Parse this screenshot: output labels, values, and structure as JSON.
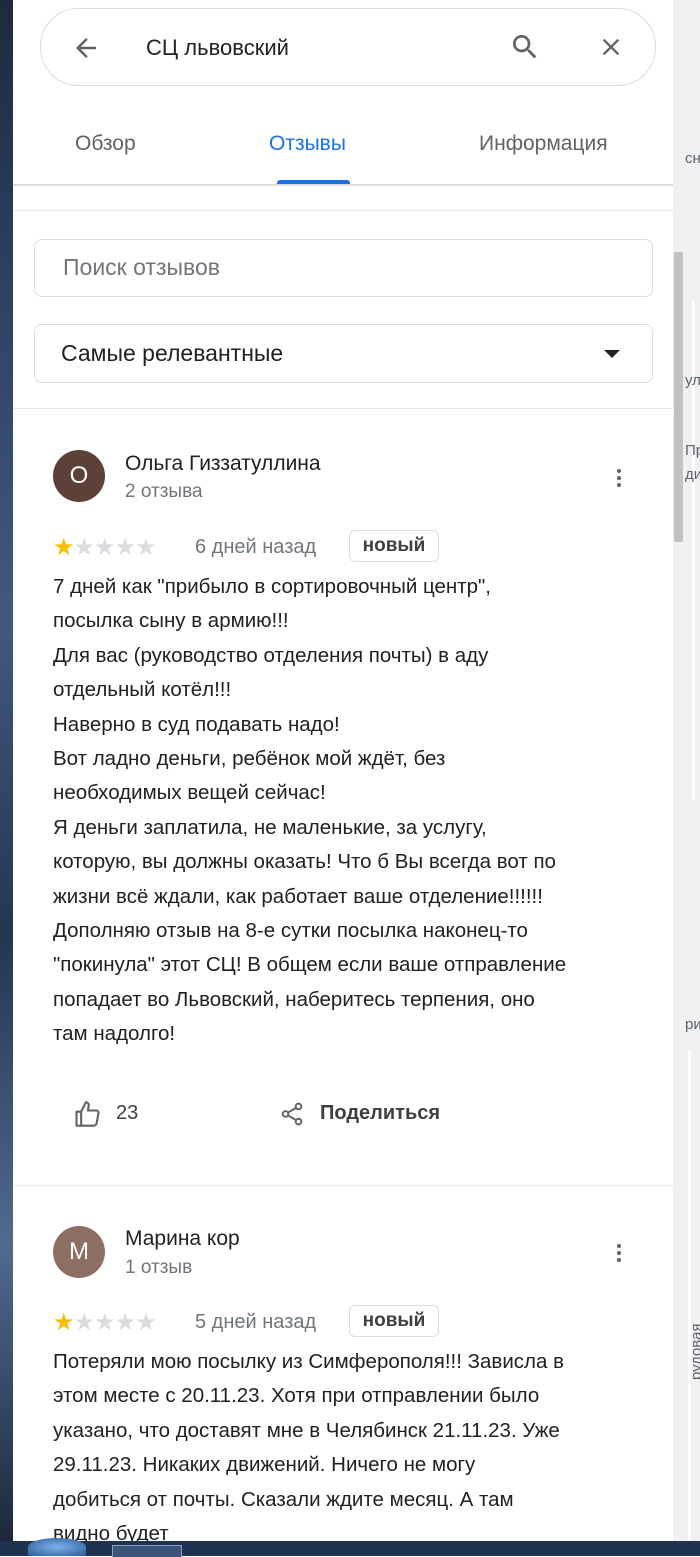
{
  "search": {
    "query": "СЦ львовский"
  },
  "tabs": [
    {
      "label": "Обзор"
    },
    {
      "label": "Отзывы"
    },
    {
      "label": "Информация"
    }
  ],
  "review_search": {
    "placeholder": "Поиск отзывов"
  },
  "sort": {
    "selected": "Самые релевантные"
  },
  "reviews": [
    {
      "avatar_letter": "О",
      "avatar_color": "#5d4037",
      "author": "Ольга Гиззатуллина",
      "count": "2 отзыва",
      "rating": 1,
      "date": "6 дней назад",
      "badge": "новый",
      "text": "7 дней как \"прибыло в сортировочный центр\",\nпосылка сыну в армию!!!\nДля вас (руководство отделения почты) в аду\nотдельный котёл!!!\nНаверно в суд подавать надо!\nВот ладно деньги, ребёнок мой ждёт, без\nнеобходимых вещей сейчас!\nЯ деньги заплатила, не маленькие, за услугу,\nкоторую, вы должны оказать! Что б Вы всегда вот по\nжизни всё ждали, как работает ваше отделение!!!!!!\nДополняю отзыв на 8-е сутки посылка наконец-то\n\"покинула\" этот СЦ! В общем если ваше отправление\nпопадает во Львовский, наберитесь терпения, оно\nтам надолго!",
      "likes": "23",
      "share_label": "Поделиться"
    },
    {
      "avatar_letter": "М",
      "avatar_color": "#8d6e63",
      "author": "Марина кор",
      "count": "1 отзыв",
      "rating": 1,
      "date": "5 дней назад",
      "badge": "новый",
      "text": "Потеряли мою посылку из Симферополя!!! Зависла в\nэтом месте с 20.11.23. Хотя при отправлении было\nуказано, что доставят мне в Челябинск 21.11.23. Уже\n29.11.23. Никаких движений. Ничего не могу\nдобиться от почты. Сказали ждите месяц. А там\nвидно будет"
    }
  ],
  "map_labels": [
    "сн",
    "ул",
    "Пр",
    "ди",
    "ри",
    "рудовая"
  ],
  "colors": {
    "accent": "#1a73e8",
    "star": "#fbbc04"
  }
}
